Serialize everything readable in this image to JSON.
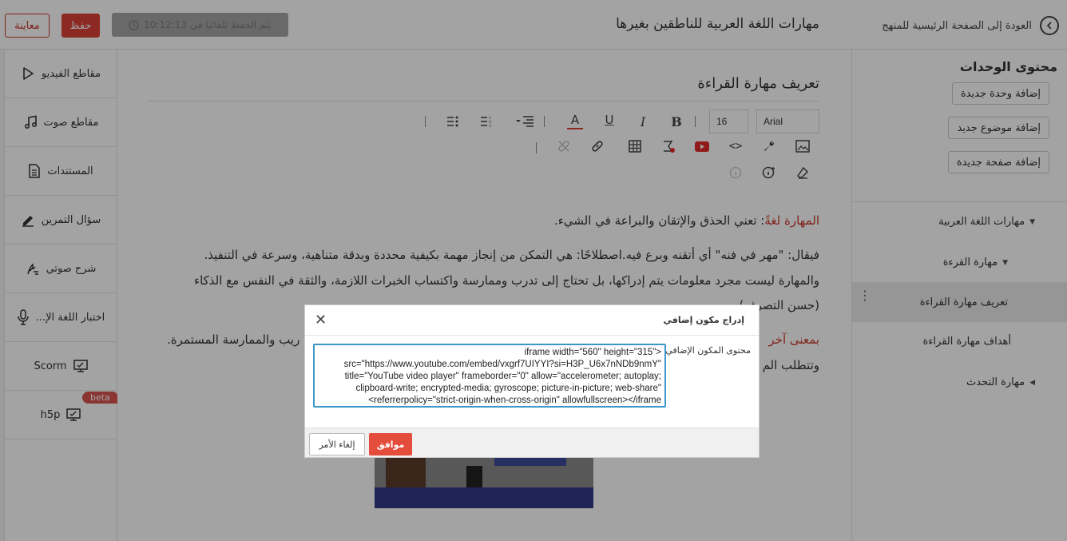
{
  "header": {
    "preview_label": "معاينة",
    "save_label": "حفظ",
    "autosave_text": "يتم الحفظ تلقائيا في 10:12:13",
    "course_title": "مهارات اللغة العربية للناطقين بغيرها",
    "back_label": "العودة إلى الصفحة الرئيسية للمنهج"
  },
  "tools": [
    {
      "label": "مقاطع الفيديو",
      "icon": "play-icon"
    },
    {
      "label": "مقاطع صوت",
      "icon": "music-icon"
    },
    {
      "label": "المستندات",
      "icon": "document-icon"
    },
    {
      "label": "سؤال التمرين",
      "icon": "pencil-icon"
    },
    {
      "label": "شرح صوتي",
      "icon": "voice-explain-icon"
    },
    {
      "label": "اختبار اللغة الإ...",
      "icon": "microphone-icon"
    },
    {
      "label": "Scorm",
      "icon": "screen-icon"
    },
    {
      "label": "h5p",
      "icon": "screen-icon",
      "badge": "beta"
    }
  ],
  "units": {
    "title": "محتوى الوحدات",
    "add_unit": "إضافة وحدة جديدة",
    "add_topic": "إضافة موضوع جديد",
    "add_page": "إضافة صفحة جديدة",
    "tree": [
      {
        "label": "مهارات اللغة العربية",
        "expanded": true
      },
      {
        "label": "مهارة القرءة",
        "expanded": true
      },
      {
        "label": "تعريف مهارة القراءة",
        "selected": true
      },
      {
        "label": "أهداف مهارة القراءة"
      },
      {
        "label": "مهارة التحدث",
        "expanded": false
      }
    ]
  },
  "editor": {
    "page_title": "تعريف مهارة القراءة",
    "font_family": "Arial",
    "font_size": "16",
    "content": {
      "line1_red": "المهارة لغةً",
      "line1_rest": ": تعني الحذق والإتقان والبراعة في الشيء.",
      "line2": "فيقال: \"مهر في فنه\" أي أتقنه وبرع فيه.اصطلاحًا: هي التمكن من إنجاز مهمة بكيفية محددة وبدقة متناهية، وسرعة في التنفيذ.",
      "line3": "والمهارة ليست مجرد معلومات يتم إدراكها، بل تحتاج إلى تدرب وممارسة واكتساب الخبرات اللازمة، والثقة في النفس مع الذكاء",
      "line4": "(حسن التصرف)",
      "line5_red": "بمعنى آخر",
      "line5_rest": "ريب والممارسة المستمرة.",
      "line6": "وتتطلب الم"
    }
  },
  "dialog": {
    "title": "إدراج مكون إضافي",
    "field_label": "محتوى المكون الإضافي",
    "embed_code": "<iframe width=\"560\" height=\"315\" src=\"https://www.youtube.com/embed/vxgrf7UIYYI?si=H3P_U6x7nNDb9nmY\" title=\"YouTube video player\" frameborder=\"0\" allow=\"accelerometer; autoplay; clipboard-write; encrypted-media; gyroscope; picture-in-picture; web-share\" referrerpolicy=\"strict-origin-when-cross-origin\" allowfullscreen></iframe>",
    "ok_label": "موافق",
    "cancel_label": "إلغاء الأمر"
  },
  "colors": {
    "accent_red": "#d94136",
    "ok_button": "#e44c3c",
    "focus_blue": "#3c97c8"
  }
}
